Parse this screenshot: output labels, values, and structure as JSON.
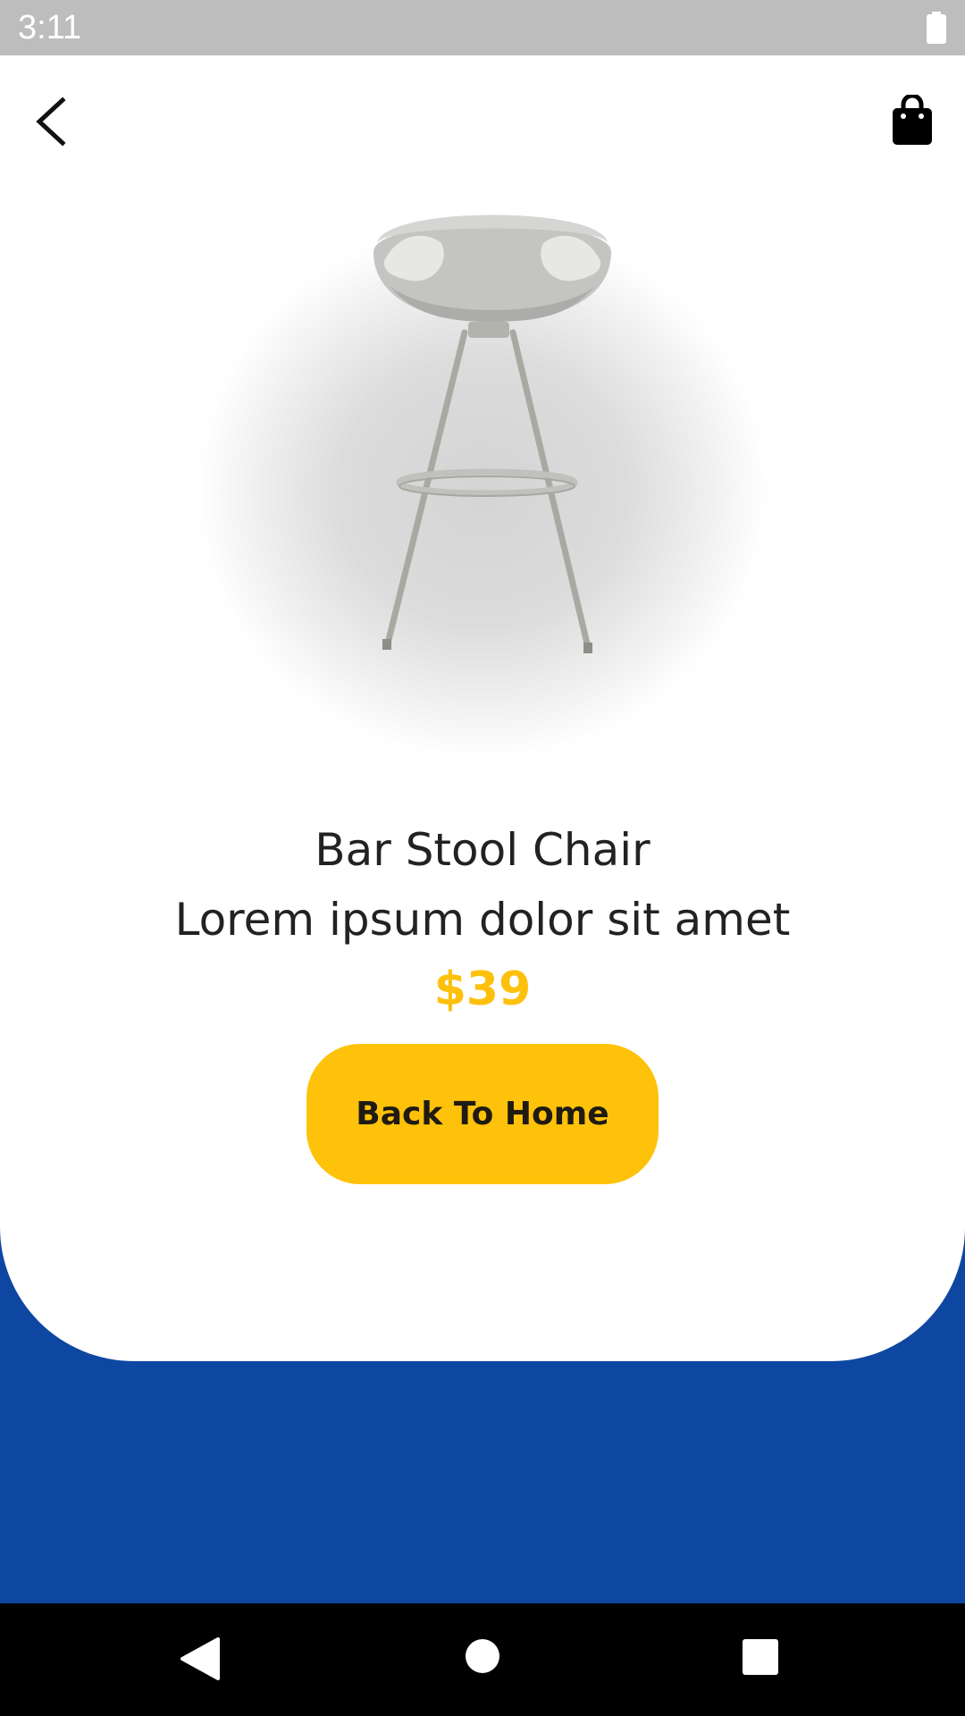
{
  "status_bar": {
    "time": "3:11",
    "battery_icon": "battery-full-icon"
  },
  "toolbar": {
    "back_icon": "chevron-left-icon",
    "cart_icon": "shopping-bag-icon"
  },
  "product": {
    "image": "bar-stool-chair-image",
    "title": "Bar Stool Chair",
    "description": "Lorem ipsum dolor sit amet",
    "price": "$39"
  },
  "actions": {
    "back_to_home_label": "Back To Home"
  },
  "nav_bar": {
    "back_icon": "triangle-back-icon",
    "home_icon": "circle-home-icon",
    "recents_icon": "square-recents-icon"
  },
  "colors": {
    "accent": "#fec20a",
    "price": "#fdc10d",
    "background_blue": "#0e47a1",
    "status_bar": "#bdbdbd"
  }
}
